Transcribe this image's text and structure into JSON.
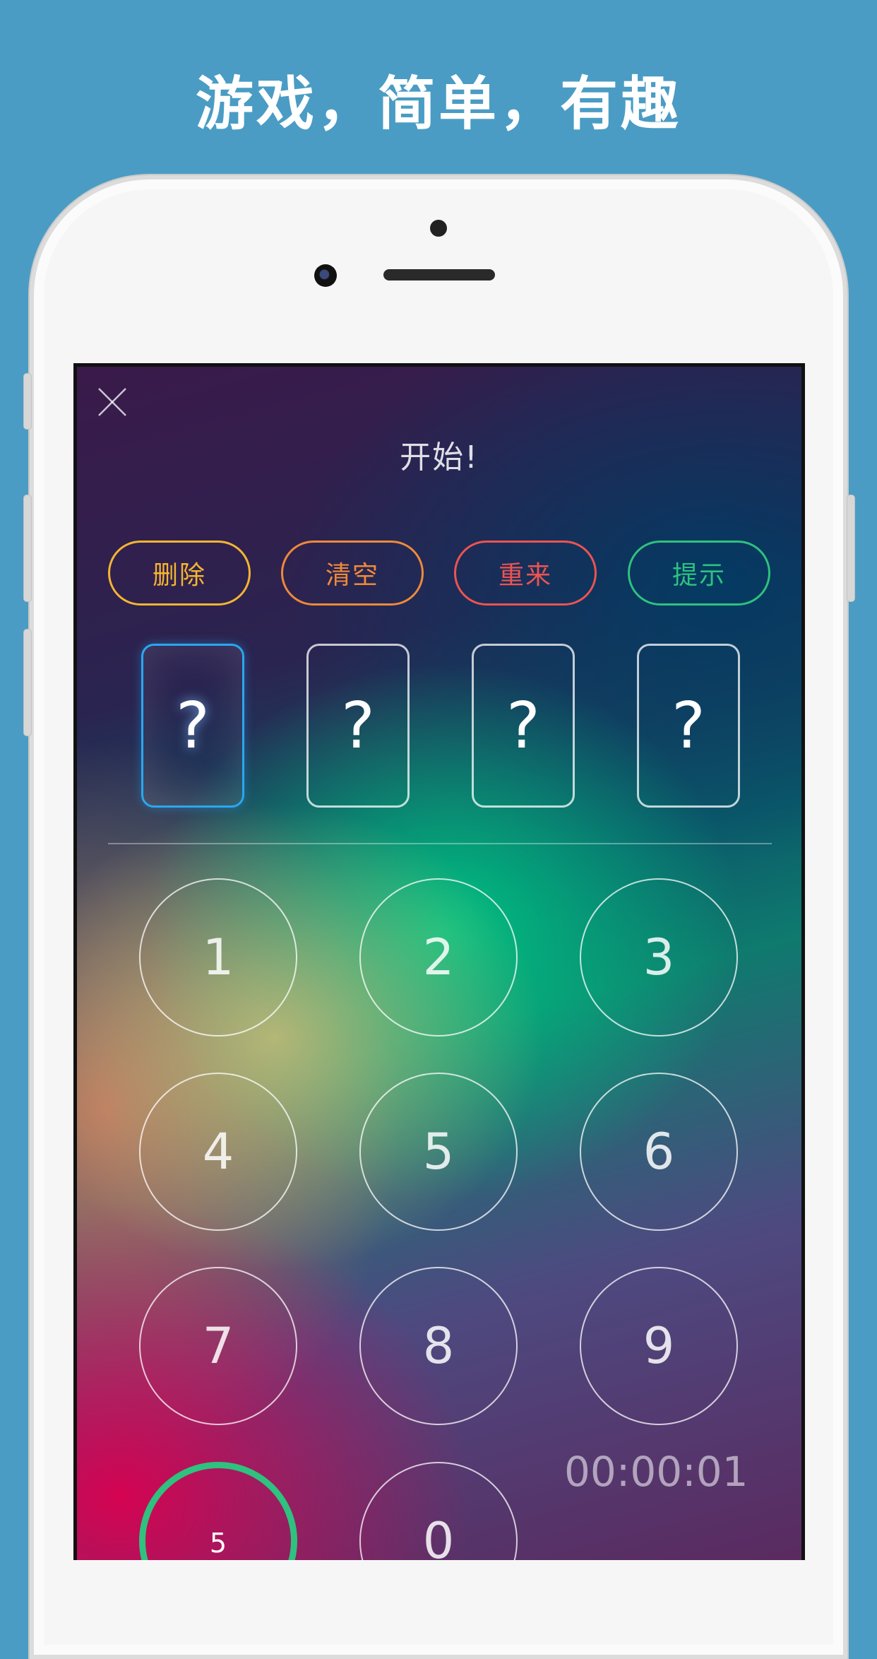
{
  "banner": {
    "headline": "游戏，简单，有趣"
  },
  "game": {
    "title": "开始!",
    "actions": [
      {
        "label": "删除",
        "color": "#f5b531"
      },
      {
        "label": "清空",
        "color": "#f0893a"
      },
      {
        "label": "重来",
        "color": "#ee5350"
      },
      {
        "label": "提示",
        "color": "#2ec27e"
      }
    ],
    "slots": [
      "?",
      "?",
      "?",
      "?"
    ],
    "active_slot": 1,
    "keypad": [
      "1",
      "2",
      "3",
      "4",
      "5",
      "6",
      "7",
      "8",
      "9",
      "0"
    ],
    "countdown": "5",
    "timer": "00:00:01"
  },
  "icons": {
    "close": "close-icon"
  }
}
